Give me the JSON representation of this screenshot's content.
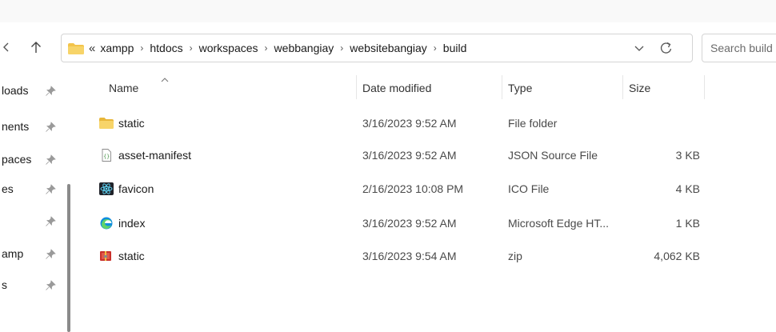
{
  "address_bar": {
    "overflow_glyph": "«",
    "separator_glyph": "›",
    "crumbs": [
      "xampp",
      "htdocs",
      "workspaces",
      "webbangiay",
      "websitebangiay",
      "build"
    ]
  },
  "search": {
    "placeholder": "Search build"
  },
  "sidebar": {
    "items": [
      {
        "label": "loads",
        "icon": "pin-icon"
      },
      {
        "label": "nents",
        "icon": "pin-icon"
      },
      {
        "label": "paces",
        "icon": "pin-icon"
      },
      {
        "label": "es",
        "icon": "pin-icon"
      },
      {
        "label": "",
        "icon": "pin-icon"
      },
      {
        "label": "amp",
        "icon": "pin-icon"
      },
      {
        "label": "s",
        "icon": "pin-icon"
      }
    ]
  },
  "file_list": {
    "columns": [
      "Name",
      "Date modified",
      "Type",
      "Size"
    ],
    "rows": [
      {
        "name": "static",
        "date": "3/16/2023 9:52 AM",
        "type": "File folder",
        "size": "",
        "icon": "folder-icon"
      },
      {
        "name": "asset-manifest",
        "date": "3/16/2023 9:52 AM",
        "type": "JSON Source File",
        "size": "3 KB",
        "icon": "json-file-icon"
      },
      {
        "name": "favicon",
        "date": "2/16/2023 10:08 PM",
        "type": "ICO File",
        "size": "4 KB",
        "icon": "react-icon"
      },
      {
        "name": "index",
        "date": "3/16/2023 9:52 AM",
        "type": "Microsoft Edge HT...",
        "size": "1 KB",
        "icon": "edge-icon"
      },
      {
        "name": "static",
        "date": "3/16/2023 9:54 AM",
        "type": "zip",
        "size": "4,062 KB",
        "icon": "zip-archive-icon"
      }
    ]
  },
  "colors": {
    "folder": "#f3c44b",
    "edge": "#0f8de0",
    "react": "#61dafb",
    "zip": "#c9302c"
  }
}
